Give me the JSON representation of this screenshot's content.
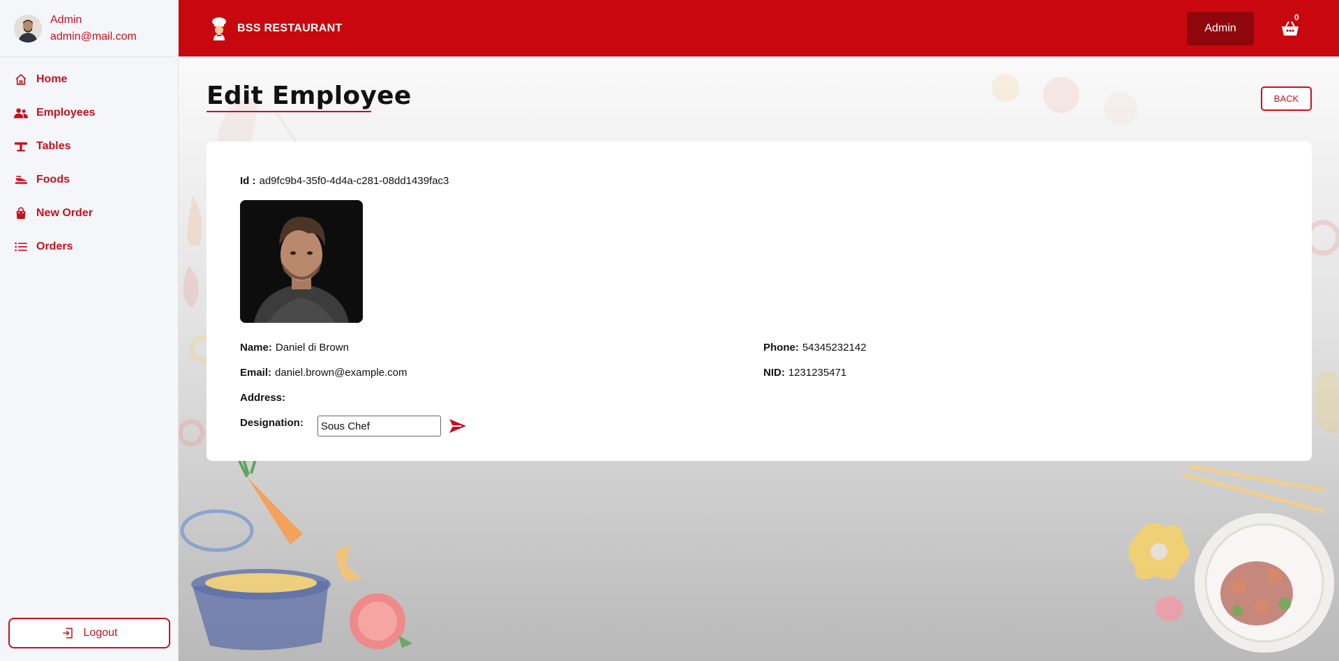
{
  "user": {
    "name": "Admin",
    "email": "admin@mail.com"
  },
  "sidebar": {
    "items": [
      {
        "label": "Home",
        "icon": "home-icon"
      },
      {
        "label": "Employees",
        "icon": "users-icon"
      },
      {
        "label": "Tables",
        "icon": "table-icon"
      },
      {
        "label": "Foods",
        "icon": "food-icon"
      },
      {
        "label": "New Order",
        "icon": "shopping-bag-icon"
      },
      {
        "label": "Orders",
        "icon": "list-icon"
      }
    ],
    "logout_label": "Logout"
  },
  "header": {
    "brand": "BSS RESTAURANT",
    "admin_label": "Admin",
    "cart_count": "0"
  },
  "page": {
    "title": "Edit Employee",
    "back_label": "BACK"
  },
  "employee": {
    "id_label": "Id :",
    "id": "ad9fc9b4-35f0-4d4a-c281-08dd1439fac3",
    "name_label": "Name:",
    "name": "Daniel di Brown",
    "phone_label": "Phone:",
    "phone": "54345232142",
    "email_label": "Email:",
    "email": "daniel.brown@example.com",
    "nid_label": "NID:",
    "nid": "1231235471",
    "address_label": "Address:",
    "address": "",
    "designation_label": "Designation:",
    "designation": "Sous Chef"
  },
  "colors": {
    "brand_red": "#c8080e",
    "dark_red": "#8f060c",
    "accent": "#c8101b"
  }
}
